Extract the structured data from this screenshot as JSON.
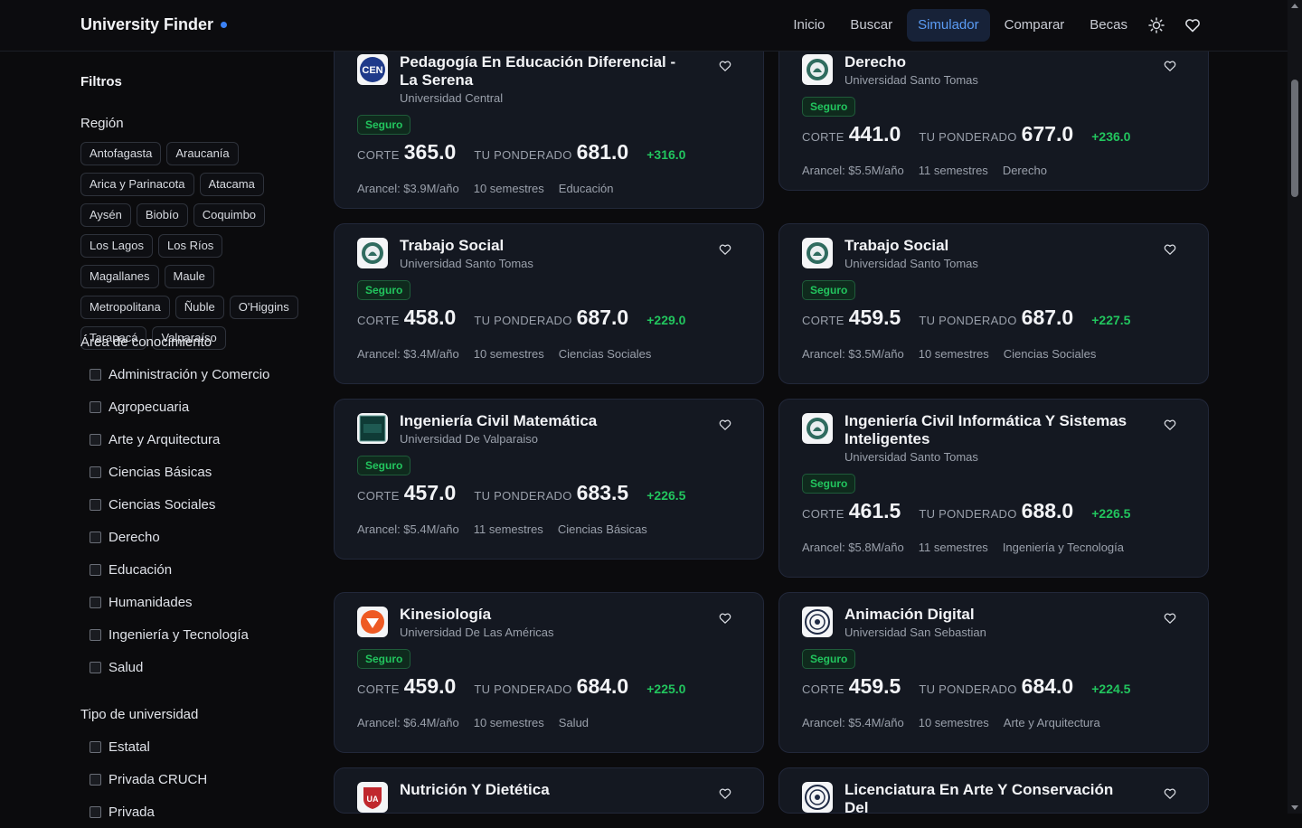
{
  "header": {
    "brand": "University Finder",
    "nav": [
      "Inicio",
      "Buscar",
      "Simulador",
      "Comparar",
      "Becas"
    ],
    "active_nav": "Simulador",
    "icons": [
      "sun-icon",
      "heart-icon"
    ],
    "accent": "#5b9cf5"
  },
  "sidebar": {
    "title": "Filtros",
    "region": {
      "title": "Región",
      "chips": [
        "Antofagasta",
        "Araucanía",
        "Arica y Parinacota",
        "Atacama",
        "Aysén",
        "Biobío",
        "Coquimbo",
        "Los Lagos",
        "Los Ríos",
        "Magallanes",
        "Maule",
        "Metropolitana",
        "Ñuble",
        "O'Higgins",
        "Tarapacá",
        "Valparaíso"
      ]
    },
    "area": {
      "title": "Área de conocimiento",
      "options": [
        "Administración y Comercio",
        "Agropecuaria",
        "Arte y Arquitectura",
        "Ciencias Básicas",
        "Ciencias Sociales",
        "Derecho",
        "Educación",
        "Humanidades",
        "Ingeniería y Tecnología",
        "Salud"
      ]
    },
    "tipo": {
      "title": "Tipo de universidad",
      "options": [
        "Estatal",
        "Privada CRUCH",
        "Privada"
      ]
    }
  },
  "labels": {
    "corte": "CORTE",
    "ponderado": "TU PONDERADO"
  },
  "cards": [
    {
      "program": "Pedagogía En Educación Diferencial - La Serena",
      "university": "Universidad Central",
      "badge": "Seguro",
      "corte": "365.0",
      "ponderado": "681.0",
      "diff": "+316.0",
      "arancel": "Arancel: $3.9M/año",
      "semestres": "10 semestres",
      "area": "Educación",
      "logo": "ucen"
    },
    {
      "program": "Derecho",
      "university": "Universidad Santo Tomas",
      "badge": "Seguro",
      "corte": "441.0",
      "ponderado": "677.0",
      "diff": "+236.0",
      "arancel": "Arancel: $5.5M/año",
      "semestres": "11 semestres",
      "area": "Derecho",
      "logo": "ust"
    },
    {
      "program": "Trabajo Social",
      "university": "Universidad Santo Tomas",
      "badge": "Seguro",
      "corte": "458.0",
      "ponderado": "687.0",
      "diff": "+229.0",
      "arancel": "Arancel: $3.4M/año",
      "semestres": "10 semestres",
      "area": "Ciencias Sociales",
      "logo": "ust"
    },
    {
      "program": "Trabajo Social",
      "university": "Universidad Santo Tomas",
      "badge": "Seguro",
      "corte": "459.5",
      "ponderado": "687.0",
      "diff": "+227.5",
      "arancel": "Arancel: $3.5M/año",
      "semestres": "10 semestres",
      "area": "Ciencias Sociales",
      "logo": "ust"
    },
    {
      "program": "Ingeniería Civil Matemática",
      "university": "Universidad De Valparaiso",
      "badge": "Seguro",
      "corte": "457.0",
      "ponderado": "683.5",
      "diff": "+226.5",
      "arancel": "Arancel: $5.4M/año",
      "semestres": "11 semestres",
      "area": "Ciencias Básicas",
      "logo": "uv"
    },
    {
      "program": "Ingeniería Civil Informática Y Sistemas Inteligentes",
      "university": "Universidad Santo Tomas",
      "badge": "Seguro",
      "corte": "461.5",
      "ponderado": "688.0",
      "diff": "+226.5",
      "arancel": "Arancel: $5.8M/año",
      "semestres": "11 semestres",
      "area": "Ingeniería y Tecnología",
      "logo": "ust"
    },
    {
      "program": "Kinesiología",
      "university": "Universidad De Las Américas",
      "badge": "Seguro",
      "corte": "459.0",
      "ponderado": "684.0",
      "diff": "+225.0",
      "arancel": "Arancel: $6.4M/año",
      "semestres": "10 semestres",
      "area": "Salud",
      "logo": "udla"
    },
    {
      "program": "Animación Digital",
      "university": "Universidad San Sebastian",
      "badge": "Seguro",
      "corte": "459.5",
      "ponderado": "684.0",
      "diff": "+224.5",
      "arancel": "Arancel: $5.4M/año",
      "semestres": "10 semestres",
      "area": "Arte y Arquitectura",
      "logo": "uss"
    },
    {
      "program": "Nutrición Y Dietética",
      "university": "",
      "badge": "",
      "corte": "",
      "ponderado": "",
      "diff": "",
      "arancel": "",
      "semestres": "",
      "area": "",
      "logo": "ua"
    },
    {
      "program": "Licenciatura En Arte Y Conservación Del",
      "university": "",
      "badge": "",
      "corte": "",
      "ponderado": "",
      "diff": "",
      "arancel": "",
      "semestres": "",
      "area": "",
      "logo": "uss"
    }
  ]
}
